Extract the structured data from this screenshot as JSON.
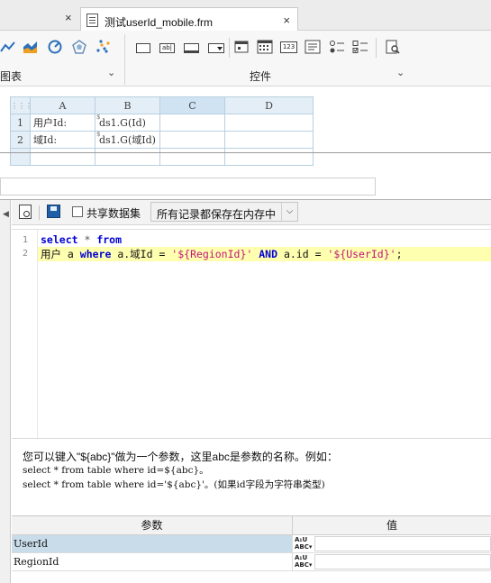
{
  "tabs": {
    "previous_close": "×",
    "active_title": "测试userId_mobile.frm",
    "active_close": "×"
  },
  "ribbon": {
    "chart_group_label": "图表",
    "controls_group_label": "控件",
    "chevron": "⌄",
    "chart_icons": [
      "bar-chart-icon",
      "area-chart-icon",
      "gauge-chart-icon",
      "radar-chart-icon",
      "scatter-chart-icon"
    ],
    "control_icons": [
      "label-control-icon",
      "text-field-icon",
      "textbox-icon",
      "dropdown-icon",
      "date-icon",
      "calendar-icon",
      "number-icon",
      "text-area-icon",
      "radio-group-icon",
      "checkbox-group-icon",
      "search-widget-icon"
    ],
    "text_field_glyph": "ab|",
    "number_glyph": "123"
  },
  "sheet": {
    "columns": [
      "A",
      "B",
      "C",
      "D"
    ],
    "selected_column": "C",
    "rows": [
      {
        "num": "1",
        "a": "用户Id:",
        "b": "ds1.G(Id)"
      },
      {
        "num": "2",
        "a": "域Id:",
        "b": "ds1.G(域Id)"
      }
    ],
    "formula_mark": "$"
  },
  "dataset_dialog": {
    "share_dataset_label": "共享数据集",
    "storage_mode": "所有记录都保存在内存中",
    "code_lines": [
      {
        "num": "1",
        "tokens": [
          {
            "t": "select",
            "c": "kw"
          },
          {
            "t": " * ",
            "c": "sym"
          },
          {
            "t": "from",
            "c": "kw"
          }
        ]
      },
      {
        "num": "2",
        "tokens": [
          {
            "t": "用户 a ",
            "c": ""
          },
          {
            "t": "where",
            "c": "kw"
          },
          {
            "t": " a.域Id = ",
            "c": ""
          },
          {
            "t": "'${RegionId}'",
            "c": "str"
          },
          {
            "t": " ",
            "c": ""
          },
          {
            "t": "AND",
            "c": "kw"
          },
          {
            "t": " a.id = ",
            "c": ""
          },
          {
            "t": "'${UserId}'",
            "c": "str"
          },
          {
            "t": ";",
            "c": ""
          }
        ]
      }
    ],
    "help_line1": "您可以键入\"${abc}\"做为一个参数，这里abc是参数的名称。例如：",
    "help_line2": "select * from table where id=${abc}。",
    "help_line3": "select * from table where id='${abc}'。(如果id字段为字符串类型)",
    "param_header_name": "参数",
    "param_header_value": "值",
    "type_badge_top": "A₁U",
    "type_badge_bottom": "ABC▾",
    "params": [
      {
        "name": "UserId",
        "value": ""
      },
      {
        "name": "RegionId",
        "value": ""
      }
    ]
  }
}
